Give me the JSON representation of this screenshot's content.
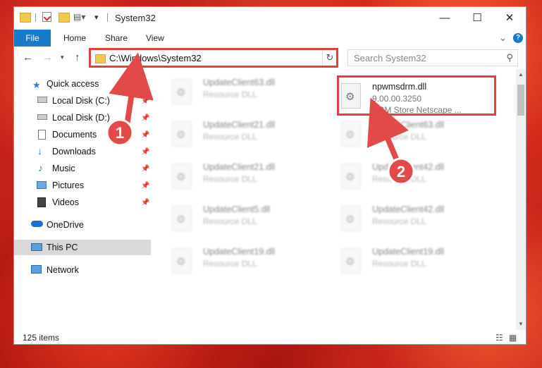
{
  "window": {
    "title": "System32",
    "controls": {
      "minimize": "—",
      "maximize": "☐",
      "close": "✕"
    }
  },
  "ribbon": {
    "tabs": [
      "File",
      "Home",
      "Share",
      "View"
    ],
    "collapse_glyph": "⌄",
    "help_glyph": "?"
  },
  "address": {
    "path": "C:\\Windows\\System32",
    "search_placeholder": "Search System32"
  },
  "sidebar": {
    "items": [
      {
        "label": "Quick access",
        "icon": "star-icon"
      },
      {
        "label": "Local Disk (C:)",
        "icon": "drive-icon",
        "pinned": true
      },
      {
        "label": "Local Disk (D:)",
        "icon": "drive-icon",
        "pinned": true
      },
      {
        "label": "Documents",
        "icon": "documents-icon",
        "pinned": true
      },
      {
        "label": "Downloads",
        "icon": "downloads-icon",
        "pinned": true
      },
      {
        "label": "Music",
        "icon": "music-icon",
        "pinned": true
      },
      {
        "label": "Pictures",
        "icon": "pictures-icon",
        "pinned": true
      },
      {
        "label": "Videos",
        "icon": "videos-icon",
        "pinned": true
      },
      {
        "label": "OneDrive",
        "icon": "cloud-icon"
      },
      {
        "label": "This PC",
        "icon": "computer-icon",
        "selected": true
      },
      {
        "label": "Network",
        "icon": "network-icon"
      }
    ]
  },
  "files": {
    "highlighted": {
      "name": "npwmsdrm.dll",
      "version": "9.00.00.3250",
      "description": "DRM Store Netscape ..."
    },
    "left_column": [
      {
        "name": "UpdateClient63.dll",
        "type": "Resource DLL"
      },
      {
        "name": "UpdateClient21.dll",
        "type": "Resource DLL"
      },
      {
        "name": "UpdateClient21.dll",
        "type": "Resource DLL"
      },
      {
        "name": "UpdateClient5.dll",
        "type": "Resource DLL"
      },
      {
        "name": "UpdateClient19.dll",
        "type": "Resource DLL"
      }
    ],
    "right_column": [
      {
        "name": "UpdateClient63.dll",
        "type": "Resource DLL"
      },
      {
        "name": "UpdateClient42.dll",
        "type": "Resource DLL"
      },
      {
        "name": "UpdateClient42.dll",
        "type": "Resource DLL"
      },
      {
        "name": "UpdateClient19.dll",
        "type": "Resource DLL"
      }
    ]
  },
  "status": {
    "item_count": "125 items"
  },
  "annotations": {
    "step1": "1",
    "step2": "2"
  },
  "colors": {
    "accent": "#1979ca",
    "highlight": "#e04040"
  }
}
